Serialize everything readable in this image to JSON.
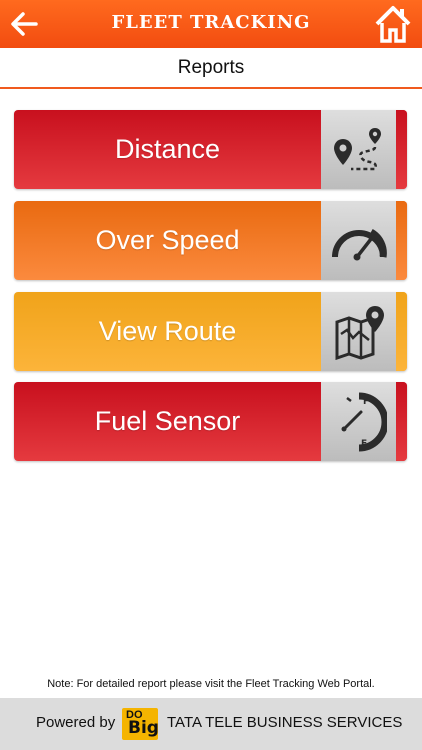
{
  "header": {
    "title": "FLEET TRACKING",
    "back_icon": "arrow-left-icon",
    "home_icon": "home-icon"
  },
  "page": {
    "title": "Reports"
  },
  "reports": [
    {
      "label": "Distance",
      "icon": "route-distance-icon",
      "color": "#d42030"
    },
    {
      "label": "Over Speed",
      "icon": "speedometer-icon",
      "color": "#f57a28"
    },
    {
      "label": "View Route",
      "icon": "map-pin-icon",
      "color": "#f5aa2a"
    },
    {
      "label": "Fuel Sensor",
      "icon": "fuel-gauge-icon",
      "color": "#d42030"
    }
  ],
  "note": "Note: For detailed report please visit the Fleet Tracking Web Portal.",
  "footer": {
    "powered_by": "Powered by",
    "logo_top": "DO",
    "logo_bottom": "Big",
    "company": "TATA TELE BUSINESS SERVICES"
  },
  "colors": {
    "header": "#f5541a",
    "accent": "#f05a1e"
  }
}
